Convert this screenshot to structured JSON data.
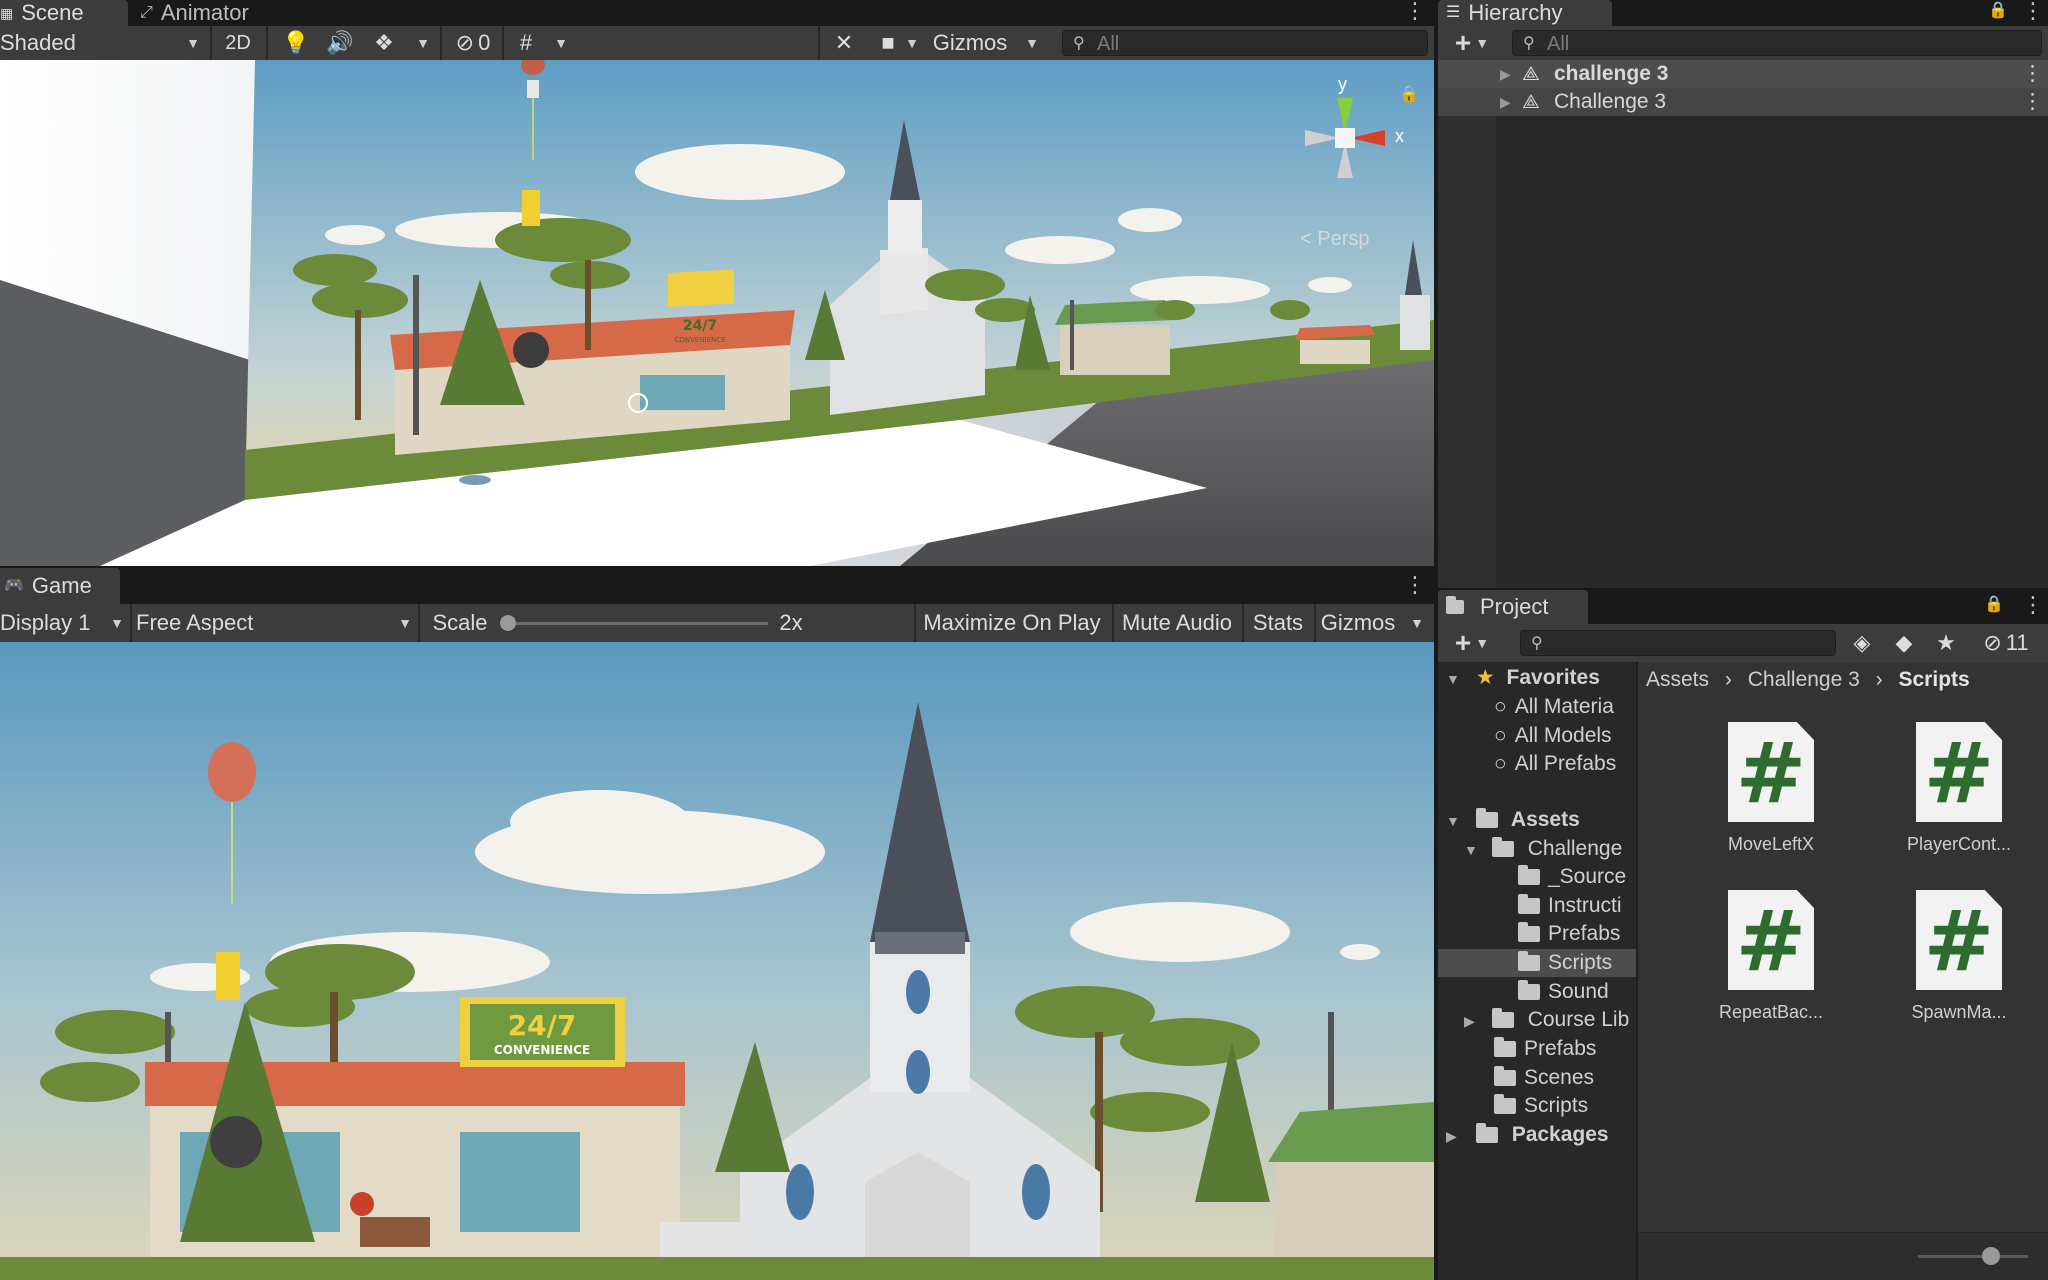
{
  "scene": {
    "tabs": [
      {
        "label": "Scene",
        "icon": "scene-icon"
      },
      {
        "label": "Animator",
        "icon": "animator-icon"
      }
    ],
    "shading_mode": "Shaded",
    "mode_2d": "2D",
    "hidden_count": "0",
    "gizmos_label": "Gizmos",
    "search_placeholder": "All",
    "persp_label": "< Persp",
    "axis_x": "x",
    "axis_y": "y",
    "store_sign": "24/7",
    "store_sub": "CONVENIENCE"
  },
  "game": {
    "tab": "Game",
    "display": "Display 1",
    "aspect": "Free Aspect",
    "scale_label": "Scale",
    "scale_value": "2x",
    "maximize": "Maximize On Play",
    "mute": "Mute Audio",
    "stats": "Stats",
    "gizmos": "Gizmos",
    "store_sign": "24/7",
    "store_sub": "CONVENIENCE"
  },
  "hierarchy": {
    "tab": "Hierarchy",
    "search_placeholder": "All",
    "items": [
      {
        "label": "challenge 3",
        "bold": true
      },
      {
        "label": "Challenge 3",
        "bold": false
      }
    ]
  },
  "project": {
    "tab": "Project",
    "hidden_count": "11",
    "favorites_label": "Favorites",
    "favorites": [
      "All Materia",
      "All Models",
      "All Prefabs"
    ],
    "assets_label": "Assets",
    "tree": {
      "challenge": "Challenge",
      "children": [
        "_Source",
        "Instructi",
        "Prefabs",
        "Scripts",
        "Sound"
      ],
      "course": "Course Lib",
      "prefabs": "Prefabs",
      "scenes": "Scenes",
      "scripts": "Scripts",
      "packages": "Packages"
    },
    "breadcrumb": [
      "Assets",
      "Challenge 3",
      "Scripts"
    ],
    "assets": [
      "MoveLeftX",
      "PlayerCont...",
      "RepeatBac...",
      "SpawnMa..."
    ]
  },
  "colors": {
    "accent_selection": "#4d4d4d",
    "script_green": "#2e6b2e",
    "favorite_star": "#f0c040"
  }
}
